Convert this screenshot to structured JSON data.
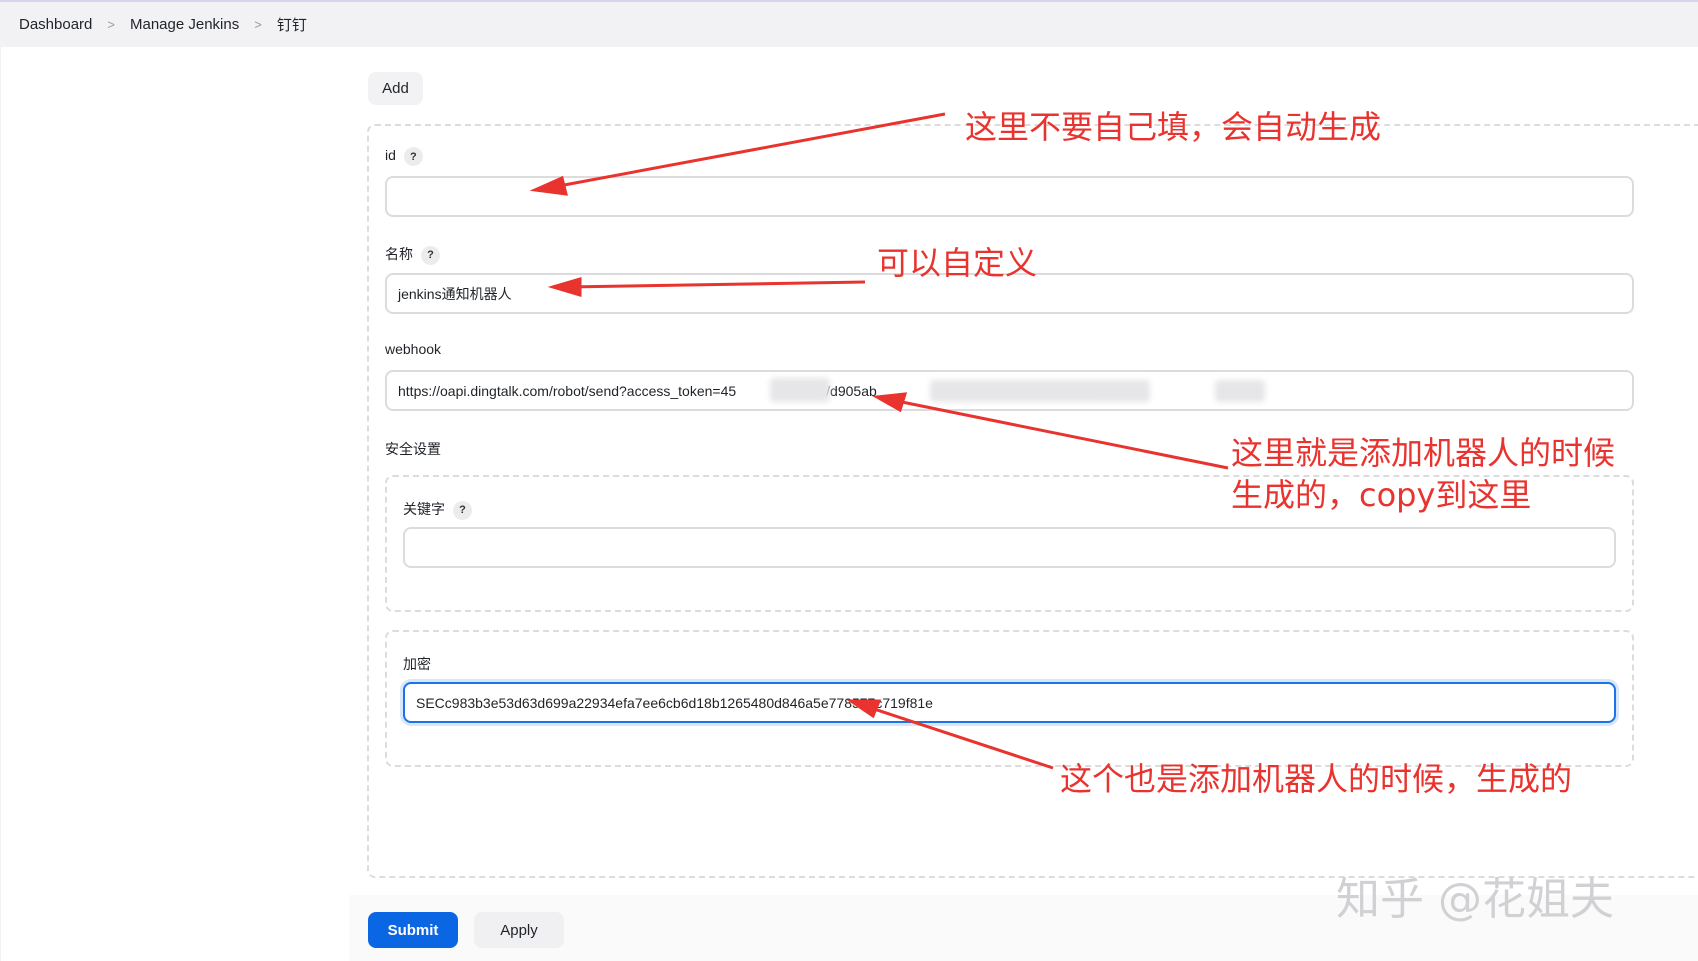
{
  "breadcrumb": {
    "items": [
      "Dashboard",
      "Manage Jenkins",
      "钉钉"
    ]
  },
  "form": {
    "add_label": "Add",
    "id": {
      "label": "id",
      "help": "?",
      "value": ""
    },
    "name": {
      "label": "名称",
      "help": "?",
      "value": "jenkins通知机器人"
    },
    "webhook": {
      "label": "webhook",
      "value_visible": "https://oapi.dingtalk.com/robot/send?access_token=45",
      "value_mid": "/d905ab",
      "value_tail": "268a16"
    },
    "security": {
      "label": "安全设置",
      "keyword": {
        "label": "关键字",
        "help": "?",
        "value": ""
      },
      "encrypt": {
        "label": "加密",
        "value": "SECc983b3e53d63d699a22934efa7ee6cb6d18b1265480d846a5e778577c719f81e"
      }
    },
    "submit_label": "Submit",
    "apply_label": "Apply"
  },
  "annotations": {
    "id_note": "这里不要自己填，会自动生成",
    "name_note": "可以自定义",
    "webhook_note_line1": "这里就是添加机器人的时候",
    "webhook_note_line2": "生成的，copy到这里",
    "encrypt_note": "这个也是添加机器人的时候，生成的"
  },
  "watermark": "知乎 @花姐夫",
  "colors": {
    "accent": "#0b66e4",
    "annotation": "#e8332e",
    "focus": "#1a73e8"
  }
}
